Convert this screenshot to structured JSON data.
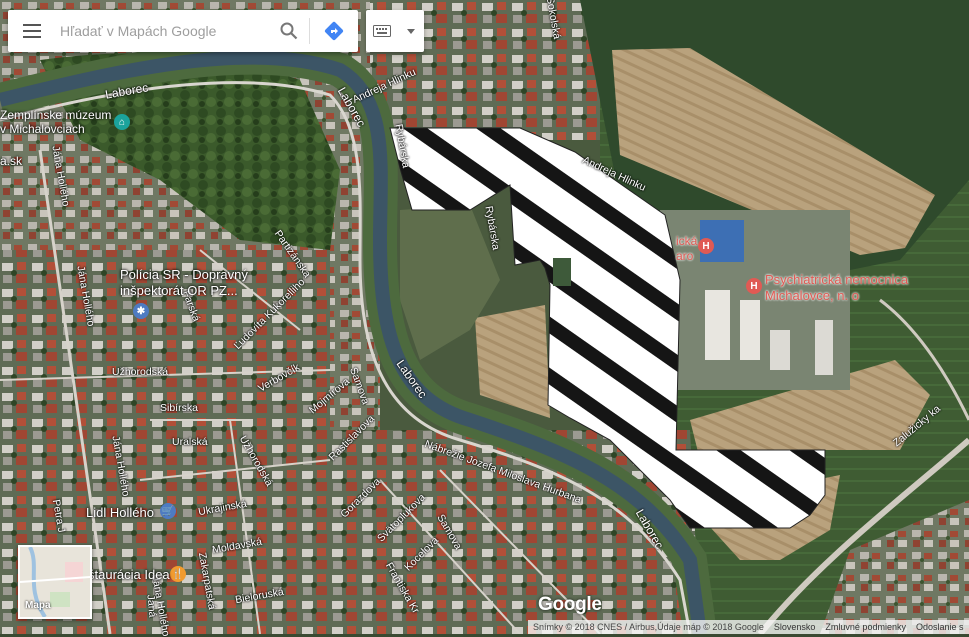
{
  "search": {
    "placeholder": "Hľadať v Mapách Google"
  },
  "icons": {
    "menu": "hamburger-menu-icon",
    "search": "magnifier-search-icon",
    "directions": "directions-diamond-icon",
    "keyboard": "keyboard-icon",
    "dropdown": "caret-down-icon"
  },
  "colors": {
    "directions_blue": "#4285f4",
    "hospital_red": "#e05a54",
    "museum_teal": "#1ba39c",
    "police_blue": "#4e7bc2",
    "shop_blue": "#4e7bc2",
    "restaurant_orange": "#f29b2e"
  },
  "map": {
    "street_labels": [
      "Laborec",
      "Laborec",
      "Laborec",
      "Laborec",
      "Jána Hollého",
      "Jána Hollého",
      "Jána Hollého",
      "Jána Hollého",
      "Partizánska",
      "Farská",
      "Ľudovíta Kukorelliho",
      "Užhorodská",
      "Verbovčík",
      "Sibírska",
      "Uralská",
      "Užhorodská",
      "Mojmírova",
      "Samova",
      "Rastislavova",
      "Nábrežie Jozefa Miloslava Hurbana",
      "Gorazdova",
      "Svätoplukova",
      "Samova",
      "Kocelova",
      "Ukrajinská",
      "Moldavská",
      "Zakarpatská",
      "Bieloruská",
      "Rybárska",
      "Rybárska",
      "Andreja Hlinku",
      "Andreja Hlinku",
      "Zalužicky ka",
      "Petra J",
      "Janá",
      "Frantiska Kr",
      "Sokolská"
    ],
    "pois": {
      "museum": "Zemplínske múzeum\nv Michalovciach",
      "police": "Polícia SR - Dopravný\ninšpektorát OR PZ...",
      "hospital_main": "Psychiatrická nemocnica\nMichalovce, n. o",
      "hospital_small": "ická\naro",
      "lidl": "Lidl Hollého",
      "restaurant": "štaurácia Idea",
      "web_frag": "a.sk"
    }
  },
  "minimap": {
    "label": "Mapa"
  },
  "logo": "Google",
  "footer": {
    "imagery": "Snímky © 2018 CNES / Airbus,Údaje máp © 2018 Google",
    "country": "Slovensko",
    "terms": "Zmluvné podmienky",
    "feedback": "Odoslanie s"
  }
}
